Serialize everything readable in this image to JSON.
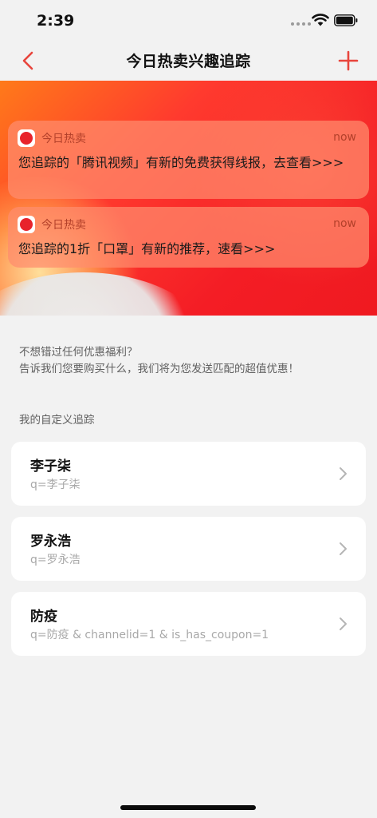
{
  "status_bar": {
    "time": "2:39"
  },
  "nav": {
    "title": "今日热卖兴趣追踪"
  },
  "notifications": [
    {
      "app_name": "今日热卖",
      "time": "now",
      "body": "您追踪的「腾讯视频」有新的免费获得线报，去查看>>>"
    },
    {
      "app_name": "今日热卖",
      "time": "now",
      "body": "您追踪的1折「口罩」有新的推荐，速看>>>"
    }
  ],
  "intro": {
    "line1": "不想错过任何优惠福利？",
    "line2": "告诉我们您要购买什么，我们将为您发送匹配的超值优惠！"
  },
  "section_label": "我的自定义追踪",
  "trackers": [
    {
      "title": "李子柒",
      "query": "q=李子柒"
    },
    {
      "title": "罗永浩",
      "query": "q=罗永浩"
    },
    {
      "title": "防疫",
      "query": "q=防疫 & channelid=1 & is_has_coupon=1"
    }
  ],
  "colors": {
    "accent": "#e8453c",
    "background": "#f2f2f2",
    "card": "#ffffff",
    "muted_text": "#a8a8a8"
  }
}
